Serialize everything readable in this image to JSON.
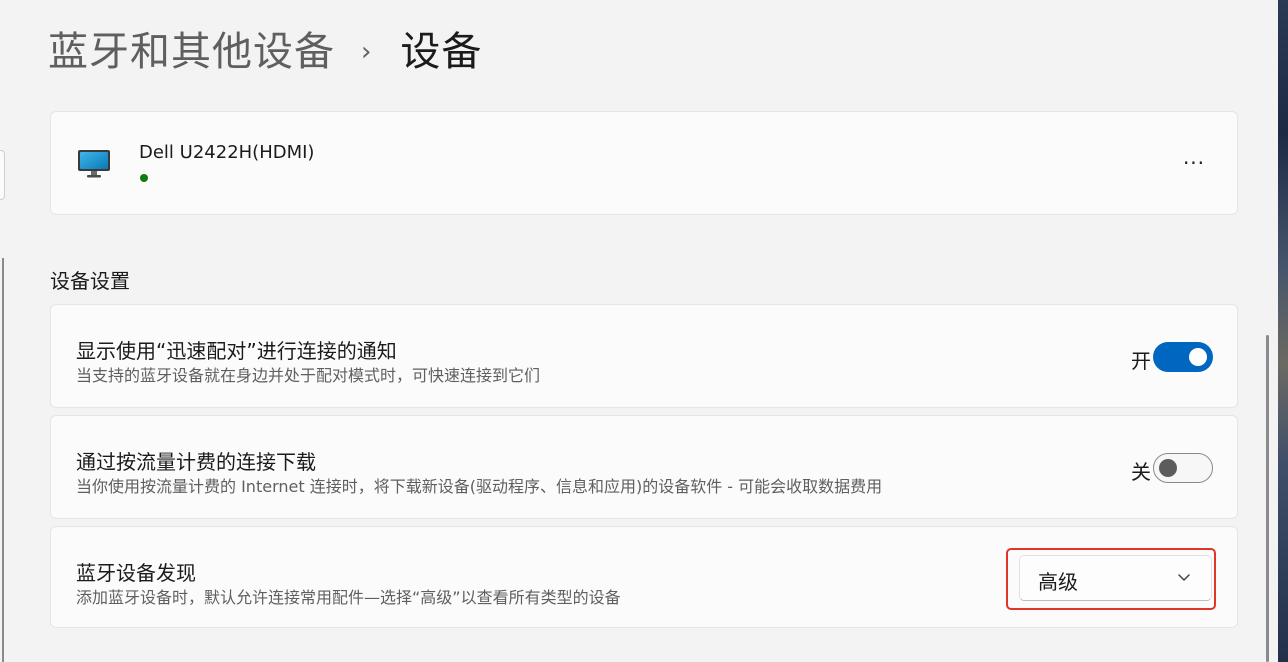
{
  "breadcrumb": {
    "parent": "蓝牙和其他设备",
    "separator": "›",
    "current": "设备"
  },
  "device": {
    "icon": "monitor-icon",
    "name": "Dell U2422H(HDMI)",
    "status_color": "#0f7b0f",
    "more_label": "···"
  },
  "section": {
    "title": "设备设置"
  },
  "settings": [
    {
      "title": "显示使用“迅速配对”进行连接的通知",
      "description": "当支持的蓝牙设备就在身边并处于配对模式时，可快速连接到它们",
      "toggle_label": "开",
      "toggle_state": "on"
    },
    {
      "title": "通过按流量计费的连接下载",
      "description": "当你使用按流量计费的 Internet 连接时，将下载新设备(驱动程序、信息和应用)的设备软件 - 可能会收取数据费用",
      "toggle_label": "关",
      "toggle_state": "off"
    },
    {
      "title": "蓝牙设备发现",
      "description": "添加蓝牙设备时，默认允许连接常用配件—选择“高级”以查看所有类型的设备",
      "dropdown_value": "高级"
    }
  ],
  "colors": {
    "accent": "#0067c0",
    "highlight": "#e0362a",
    "background": "#f3f3f3",
    "card": "#fbfbfb"
  }
}
